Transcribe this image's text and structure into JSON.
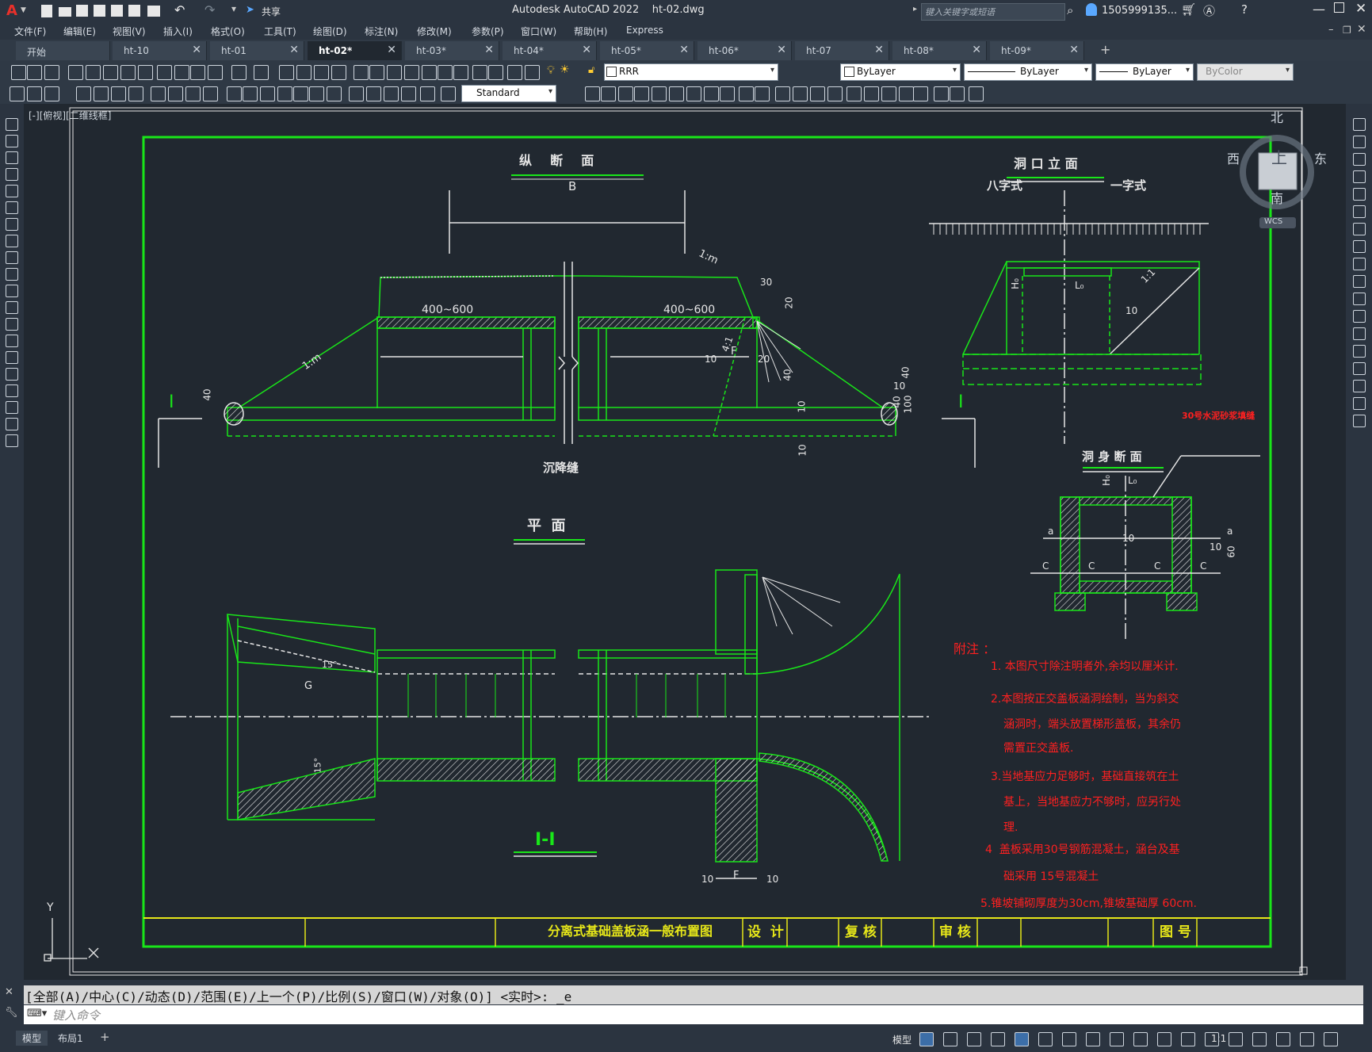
{
  "app": {
    "logo_letter": "A",
    "title": "Autodesk AutoCAD 2022    ht-02.dwg",
    "search_placeholder": "键入关键字或短语",
    "user": "1505999135...",
    "share_label": "共享"
  },
  "menu": [
    "文件(F)",
    "编辑(E)",
    "视图(V)",
    "插入(I)",
    "格式(O)",
    "工具(T)",
    "绘图(D)",
    "标注(N)",
    "修改(M)",
    "参数(P)",
    "窗口(W)",
    "帮助(H)",
    "Express"
  ],
  "tabs": [
    "开始",
    "ht-10",
    "ht-01",
    "ht-02*",
    "ht-03*",
    "ht-04*",
    "ht-05*",
    "ht-06*",
    "ht-07",
    "ht-08*",
    "ht-09*"
  ],
  "active_tab": "ht-02*",
  "toolbar": {
    "layer_combo": "RRR",
    "textstyle_combo": "Standard",
    "color_combo": "ByLayer",
    "linetype_combo": "ByLayer",
    "lineweight_combo": "ByLayer",
    "plotstyle_combo": "ByColor"
  },
  "viewport": {
    "label": "[-][俯视][二维线框]",
    "viewcube": {
      "north": "北",
      "south": "南",
      "east": "东",
      "west": "西",
      "top": "上",
      "wcs": "WCS"
    },
    "ucs_y": "Y"
  },
  "drawing": {
    "sections": {
      "longitudinal": "纵  断  面",
      "portal": "洞 口 立 面",
      "plan": "平  面",
      "barrel": "洞 身 断 面",
      "section_ii": "I-I"
    },
    "labels": {
      "B": "B",
      "slope_1m": "1:m",
      "span1": "400~600",
      "span2": "400~600",
      "settle": "沉降缝",
      "bazi": "八字式",
      "yizi": "一字式",
      "mortar": "30号水泥砂浆填缝",
      "I_left": "I",
      "I_right": "I",
      "F": "F",
      "G": "G",
      "angle15": "15°",
      "slope41": "4:1",
      "slope11": "1:1",
      "H0": "H₀",
      "L0": "L₀",
      "a": "a",
      "c": "C",
      "dims": [
        "30",
        "20",
        "40",
        "10",
        "20",
        "40",
        "10",
        "40",
        "100",
        "10",
        "10",
        "40",
        "10",
        "10",
        "10",
        "60",
        "10",
        "10"
      ]
    },
    "notes_title": "附注 ：",
    "notes": [
      "1. 本图尺寸除注明者外,余均以厘米计.",
      "2.本图按正交盖板涵洞绘制，当为斜交",
      "涵洞时，端头放置梯形盖板，其余仍",
      "需置正交盖板.",
      "3.当地基应力足够时，基础直接筑在土",
      "基上，当地基应力不够时，应另行处",
      "理.",
      "4  盖板采用30号钢筋混凝土，涵台及基",
      "础采用 15号混凝土",
      "5.锥坡铺砌厚度为30cm,锥坡基础厚 60cm."
    ],
    "titleblock": {
      "name": "分离式基础盖板涵一般布置图",
      "design": "设  计",
      "check": "复 核",
      "review": "审 核",
      "drawing_no": "图 号"
    }
  },
  "command": {
    "history": "[全部(A)/中心(C)/动态(D)/范围(E)/上一个(P)/比例(S)/窗口(W)/对象(O)] <实时>: _e",
    "placeholder": "键入命令"
  },
  "status": {
    "model_tab": "模型",
    "layout_tab": "布局1",
    "model_btn": "模型",
    "scale": "1:1"
  },
  "colors": {
    "green": "#19e619",
    "white": "#e6e6e6",
    "red": "#ff2020",
    "yellow": "#e6e619",
    "bg": "#212830"
  }
}
